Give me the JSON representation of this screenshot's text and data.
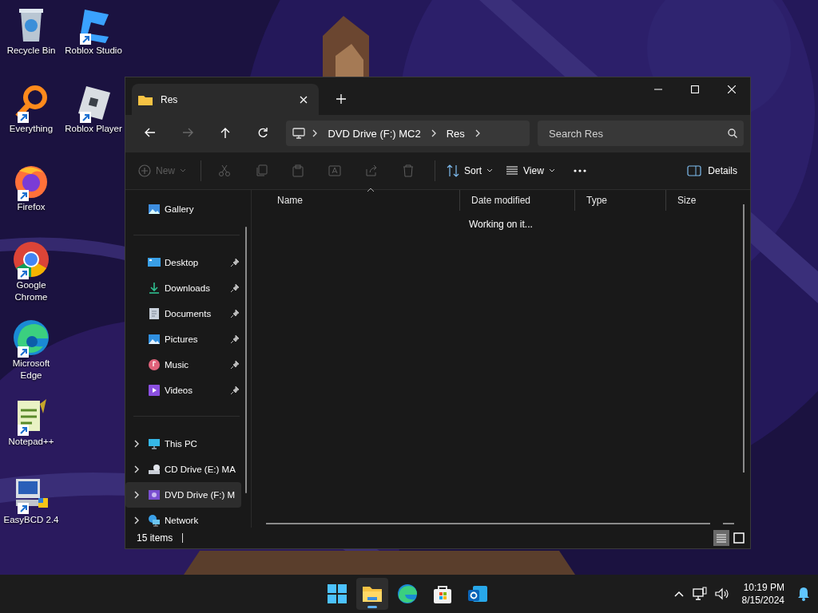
{
  "desktop": {
    "icons": [
      {
        "label": "Recycle Bin",
        "kind": "bin",
        "shortcut": false
      },
      {
        "label": "Everything",
        "kind": "everything",
        "shortcut": true
      },
      {
        "label": "Firefox",
        "kind": "firefox",
        "shortcut": true
      },
      {
        "label": "Google Chrome",
        "kind": "chrome",
        "shortcut": true
      },
      {
        "label": "Microsoft Edge",
        "kind": "edge",
        "shortcut": true
      },
      {
        "label": "Notepad++",
        "kind": "notepad",
        "shortcut": true
      },
      {
        "label": "EasyBCD 2.4",
        "kind": "easybcd",
        "shortcut": true
      },
      {
        "label": "Roblox Studio",
        "kind": "studio",
        "shortcut": true
      },
      {
        "label": "Roblox Player",
        "kind": "player",
        "shortcut": true
      }
    ]
  },
  "window": {
    "tabs": [
      {
        "title": "Res",
        "selected": true
      }
    ],
    "nav": [
      {
        "kind": "back",
        "disabled": false
      },
      {
        "kind": "forward",
        "disabled": true
      },
      {
        "kind": "up",
        "disabled": false
      },
      {
        "kind": "refresh",
        "disabled": false
      }
    ],
    "breadcrumb": [
      "DVD Drive (F:) MC2",
      "Res"
    ],
    "search": {
      "placeholder": "Search Res"
    },
    "toolbar": [
      {
        "kind": "new",
        "label": "New",
        "disabled": true,
        "dropdown": true
      },
      {
        "kind": "cut",
        "disabled": true
      },
      {
        "kind": "copy",
        "disabled": true
      },
      {
        "kind": "paste",
        "disabled": true
      },
      {
        "kind": "rename",
        "disabled": true
      },
      {
        "kind": "share",
        "disabled": true
      },
      {
        "kind": "delete",
        "disabled": true
      },
      {
        "kind": "sort",
        "label": "Sort",
        "disabled": false,
        "dropdown": true
      },
      {
        "kind": "view",
        "label": "View",
        "disabled": false,
        "dropdown": true
      },
      {
        "kind": "more",
        "disabled": false
      }
    ],
    "details_button": {
      "label": "Details"
    },
    "sidebar": {
      "groups": [
        [
          {
            "label": "Gallery",
            "kind": "gallery",
            "pinned": false,
            "expandable": false,
            "selected": false
          }
        ],
        [
          {
            "label": "Desktop",
            "kind": "desktop",
            "pinned": true,
            "expandable": false,
            "selected": false
          },
          {
            "label": "Downloads",
            "kind": "downloads",
            "pinned": true,
            "expandable": false,
            "selected": false
          },
          {
            "label": "Documents",
            "kind": "documents",
            "pinned": true,
            "expandable": false,
            "selected": false
          },
          {
            "label": "Pictures",
            "kind": "pictures",
            "pinned": true,
            "expandable": false,
            "selected": false
          },
          {
            "label": "Music",
            "kind": "music",
            "pinned": true,
            "expandable": false,
            "selected": false
          },
          {
            "label": "Videos",
            "kind": "videos",
            "pinned": true,
            "expandable": false,
            "selected": false
          }
        ],
        [
          {
            "label": "This PC",
            "kind": "pc",
            "pinned": false,
            "expandable": true,
            "selected": false
          },
          {
            "label": "CD Drive (E:) MA",
            "kind": "cd",
            "pinned": false,
            "expandable": true,
            "selected": false
          },
          {
            "label": "DVD Drive (F:) M",
            "kind": "dvd",
            "pinned": false,
            "expandable": true,
            "selected": true
          },
          {
            "label": "Network",
            "kind": "network",
            "pinned": false,
            "expandable": true,
            "selected": false
          }
        ]
      ]
    },
    "table": {
      "columns": [
        "Name",
        "Date modified",
        "Type",
        "Size"
      ],
      "message": "Working on it..."
    },
    "status_bar": {
      "count": "15 items",
      "views": [
        {
          "kind": "details",
          "selected": true
        },
        {
          "kind": "tiles",
          "selected": false
        }
      ]
    }
  },
  "taskbar": {
    "apps": [
      {
        "kind": "start",
        "active": false
      },
      {
        "kind": "explorer",
        "active": true
      },
      {
        "kind": "edge",
        "active": false
      },
      {
        "kind": "store",
        "active": false
      },
      {
        "kind": "outlook",
        "active": false
      }
    ],
    "time": "10:19 PM",
    "date": "8/15/2024"
  }
}
